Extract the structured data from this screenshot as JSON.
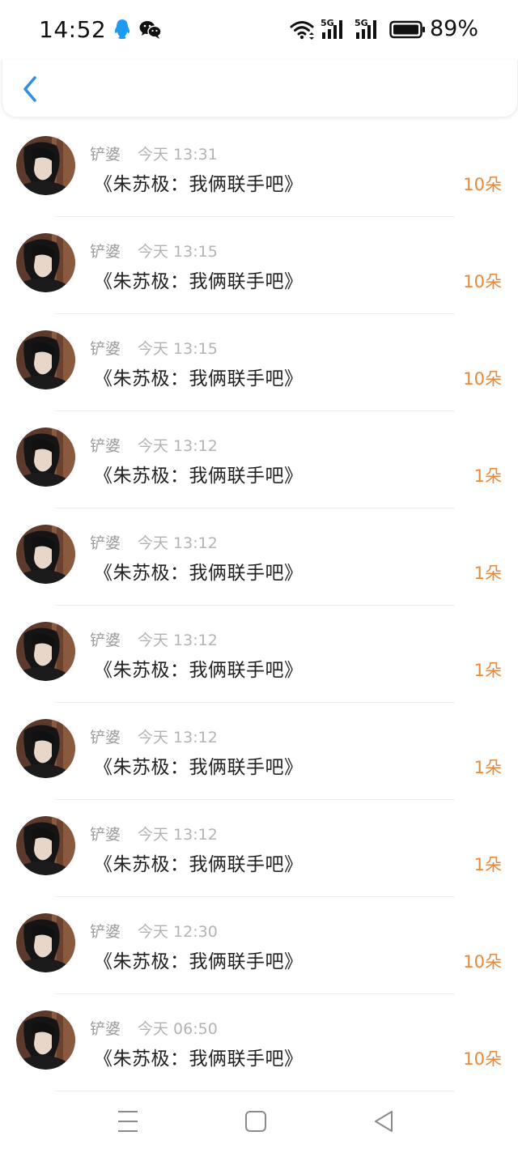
{
  "status_bar": {
    "time": "14:52",
    "notification_icons": [
      "qq-icon",
      "wechat-icon"
    ],
    "signal_icons": [
      "wifi-icon",
      "5g-signal-icon",
      "5g-signal-icon"
    ],
    "battery_percent": "89%"
  },
  "header": {
    "back_icon": "chevron-left-icon",
    "accent_color": "#2f8ee6"
  },
  "records": [
    {
      "user": "铲婆",
      "time": "今天 13:31",
      "title": "《朱苏极：我俩联手吧》",
      "amount": "10朵"
    },
    {
      "user": "铲婆",
      "time": "今天 13:15",
      "title": "《朱苏极：我俩联手吧》",
      "amount": "10朵"
    },
    {
      "user": "铲婆",
      "time": "今天 13:15",
      "title": "《朱苏极：我俩联手吧》",
      "amount": "10朵"
    },
    {
      "user": "铲婆",
      "time": "今天 13:12",
      "title": "《朱苏极：我俩联手吧》",
      "amount": "1朵"
    },
    {
      "user": "铲婆",
      "time": "今天 13:12",
      "title": "《朱苏极：我俩联手吧》",
      "amount": "1朵"
    },
    {
      "user": "铲婆",
      "time": "今天 13:12",
      "title": "《朱苏极：我俩联手吧》",
      "amount": "1朵"
    },
    {
      "user": "铲婆",
      "time": "今天 13:12",
      "title": "《朱苏极：我俩联手吧》",
      "amount": "1朵"
    },
    {
      "user": "铲婆",
      "time": "今天 13:12",
      "title": "《朱苏极：我俩联手吧》",
      "amount": "1朵"
    },
    {
      "user": "铲婆",
      "time": "今天 12:30",
      "title": "《朱苏极：我俩联手吧》",
      "amount": "10朵"
    },
    {
      "user": "铲婆",
      "time": "今天 06:50",
      "title": "《朱苏极：我俩联手吧》",
      "amount": "10朵"
    }
  ],
  "amount_color": "#e8893a",
  "nav_bar": {
    "icons": [
      "menu-icon",
      "home-square-icon",
      "back-triangle-icon"
    ]
  }
}
